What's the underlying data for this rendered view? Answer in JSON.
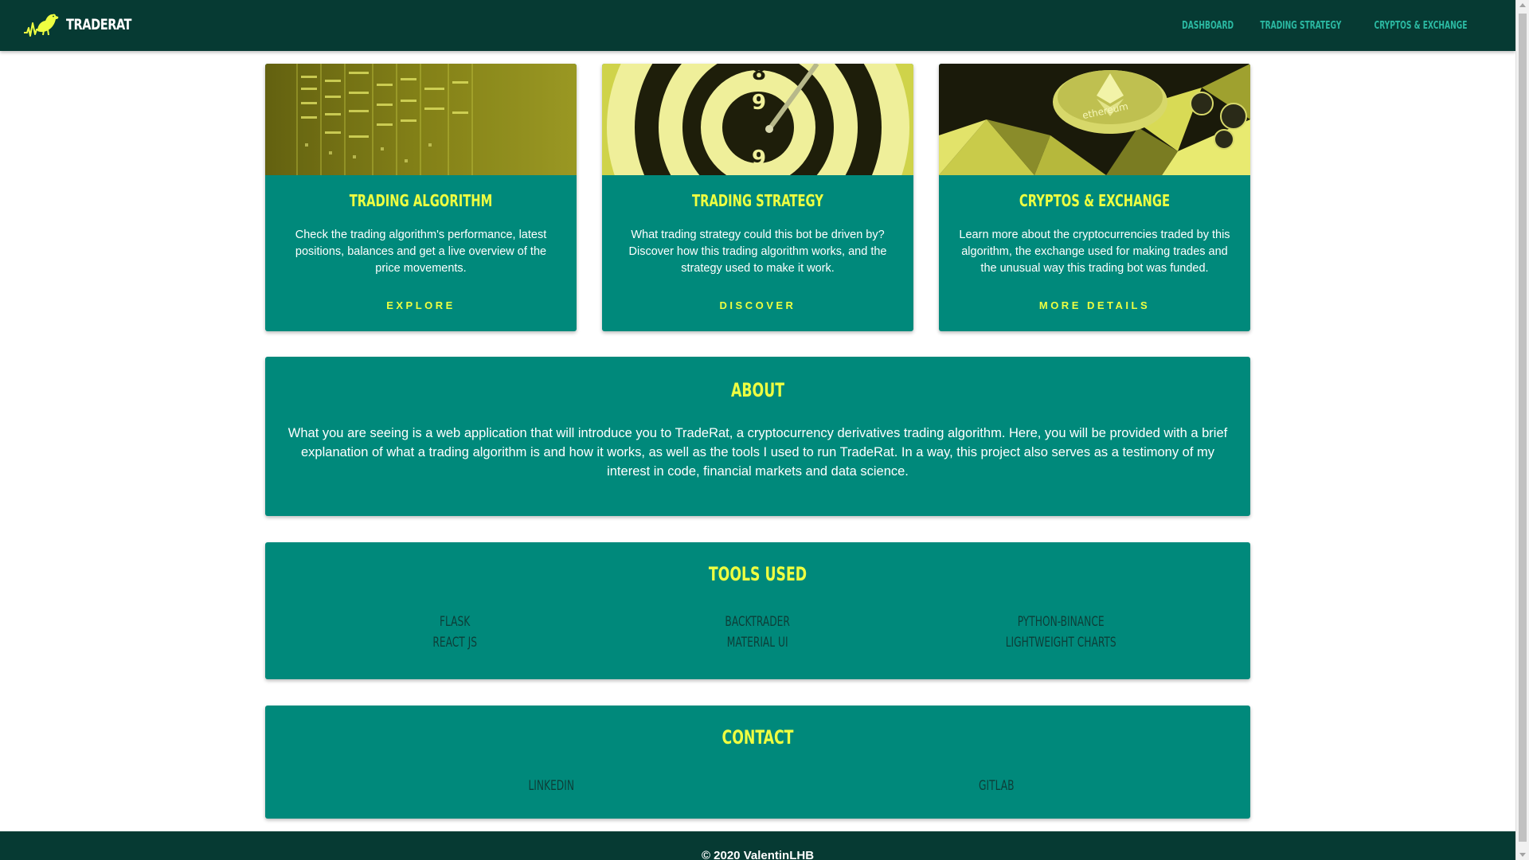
{
  "header": {
    "brand": "TRADERAT",
    "nav": [
      "DASHBOARD",
      "TRADING STRATEGY",
      "CRYPTOS & EXCHANGE"
    ]
  },
  "cards": [
    {
      "title": "TRADING ALGORITHM",
      "text": "Check the trading algorithm's performance, latest positions, balances and get a live overview of the price movements.",
      "action": "EXPLORE"
    },
    {
      "title": "TRADING STRATEGY",
      "text": "What trading strategy could this bot be driven by? Discover how this trading algorithm works, and the strategy used to make it work.",
      "action": "DISCOVER"
    },
    {
      "title": "CRYPTOS & EXCHANGE",
      "text": "Learn more about the cryptocurrencies traded by this algorithm, the exchange used for making trades and the unusual way this trading bot was funded.",
      "action": "MORE DETAILS"
    }
  ],
  "about": {
    "title": "ABOUT",
    "text": "What you are seeing is a web application that will introduce you to TradeRat, a cryptocurrency derivatives trading algorithm. Here, you will be provided with a brief explanation of what a trading algorithm is and how it works, as well as the tools I used to run TradeRat. In a way, this project also serves as a testimony of my interest in code, financial markets and data science."
  },
  "tools": {
    "title": "TOOLS USED",
    "items": [
      "FLASK",
      "BACKTRADER",
      "PYTHON-BINANCE",
      "REACT JS",
      "MATERIAL UI",
      "LIGHTWEIGHT CHARTS"
    ]
  },
  "contact": {
    "title": "CONTACT",
    "items": [
      "LINKEDIN",
      "GITLAB"
    ]
  },
  "footer": {
    "text": "© 2020 ValentinLHB"
  },
  "colors": {
    "navbar": "#063a33",
    "card": "#00897b",
    "accent": "#eeff41",
    "nav_link": "#2bb9a2",
    "dark_text": "#0d3e38"
  }
}
